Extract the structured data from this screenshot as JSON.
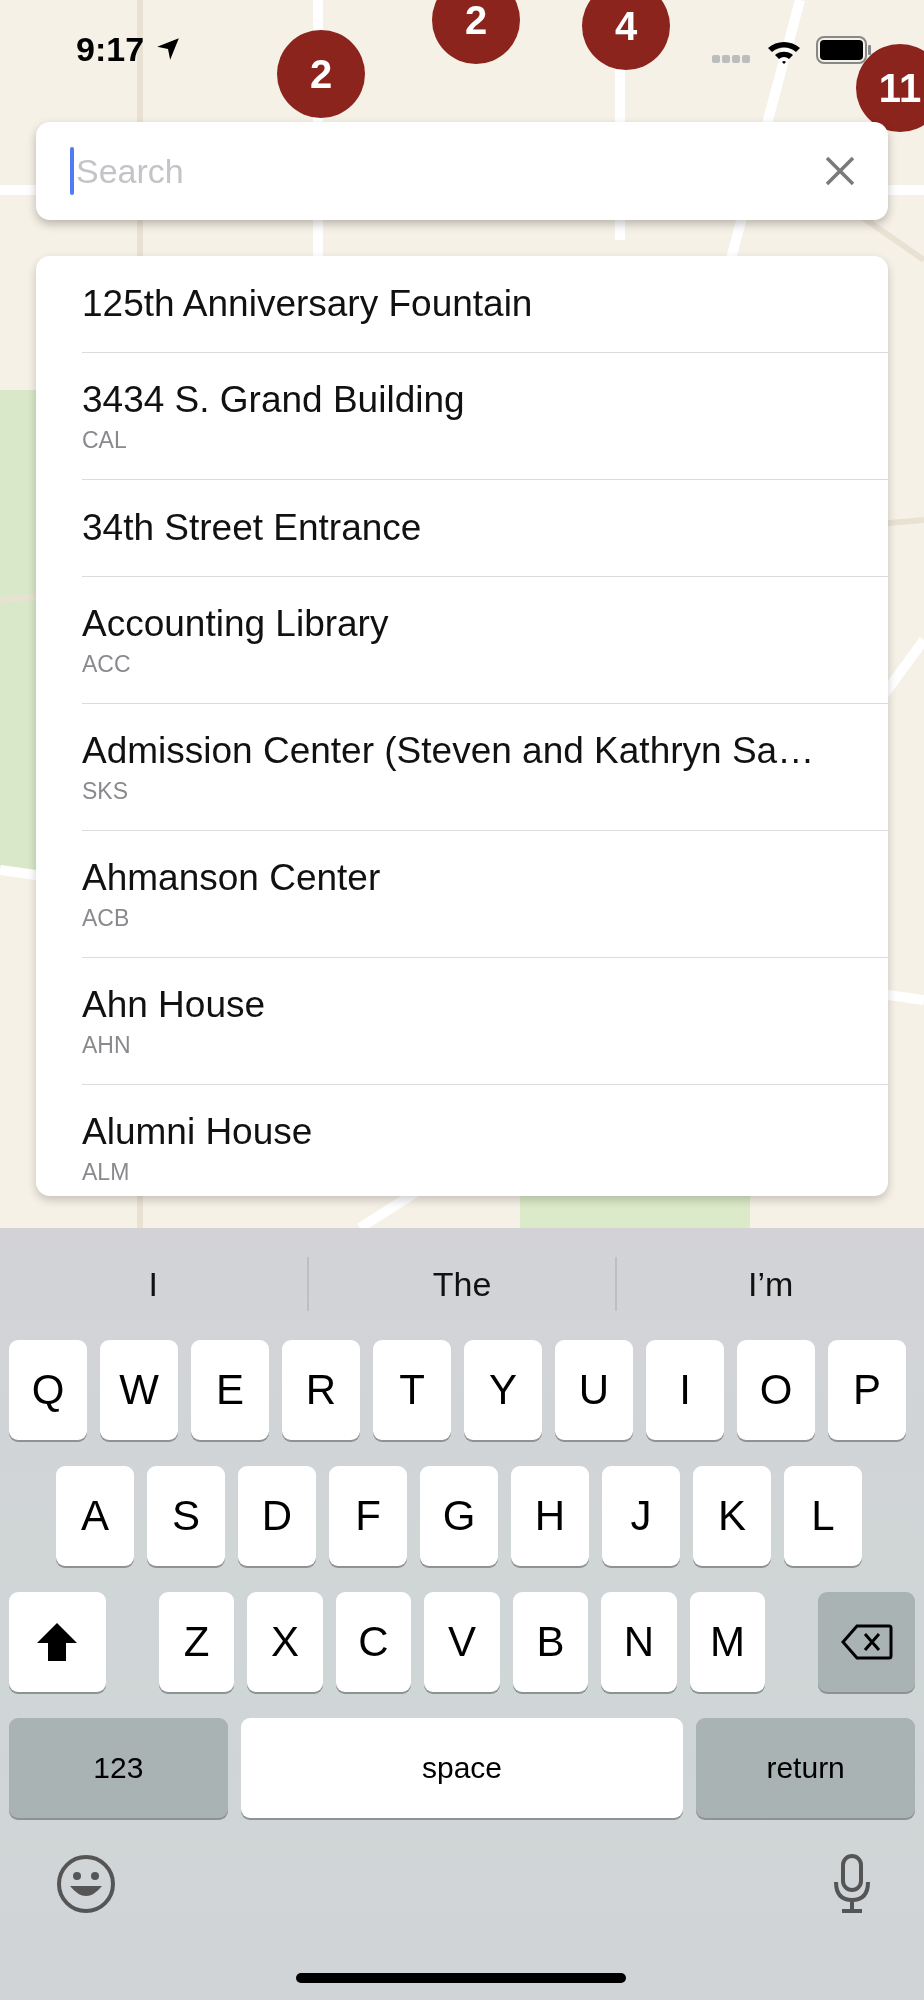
{
  "status_bar": {
    "time": "9:17"
  },
  "map": {
    "markers": [
      {
        "label": "2"
      },
      {
        "label": "4"
      },
      {
        "label": "2"
      },
      {
        "label": "11"
      }
    ]
  },
  "search": {
    "placeholder": "Search"
  },
  "results": [
    {
      "name": "125th Anniversary Fountain"
    },
    {
      "name": "3434 S. Grand Building",
      "code": "CAL"
    },
    {
      "name": "34th Street Entrance"
    },
    {
      "name": "Accounting Library",
      "code": "ACC"
    },
    {
      "name": "Admission Center (Steven and Kathryn Sa…",
      "code": "SKS"
    },
    {
      "name": "Ahmanson Center",
      "code": "ACB"
    },
    {
      "name": "Ahn House",
      "code": "AHN"
    },
    {
      "name": "Alumni House",
      "code": "ALM"
    }
  ],
  "keyboard": {
    "suggestions": [
      "I",
      "The",
      "I’m"
    ],
    "rows": [
      [
        "Q",
        "W",
        "E",
        "R",
        "T",
        "Y",
        "U",
        "I",
        "O",
        "P"
      ],
      [
        "A",
        "S",
        "D",
        "F",
        "G",
        "H",
        "J",
        "K",
        "L"
      ],
      [
        "Z",
        "X",
        "C",
        "V",
        "B",
        "N",
        "M"
      ]
    ],
    "numbers_key": "123",
    "space_key": "space",
    "return_key": "return"
  }
}
